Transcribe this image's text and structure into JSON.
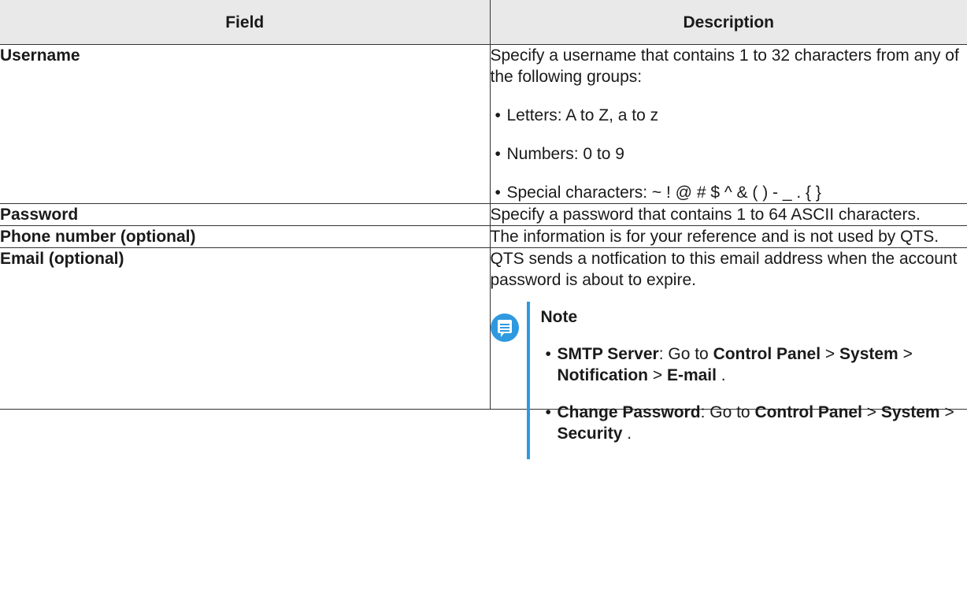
{
  "table": {
    "headers": [
      "Field",
      "Description"
    ],
    "username": {
      "field": "Username",
      "description": "Specify a username that contains 1 to 32 characters from any of the following groups:",
      "bullets": [
        "Letters: A to Z, a to z",
        "Numbers: 0 to 9",
        "Special characters: ~ ! @ # $ ^ & ( ) - _ . { }"
      ]
    },
    "password": {
      "field": "Password",
      "description": "Specify a password that contains 1 to 64 ASCII characters."
    },
    "phone": {
      "field": "Phone number (optional)",
      "description": "The information is for your reference and is not used by QTS."
    },
    "email": {
      "field": "Email (optional)",
      "description": "QTS sends a notfication to this email address when the account password is about to expire.",
      "note": {
        "title": "Note",
        "items": [
          {
            "label": "SMTP Server",
            "text": ": Go to ",
            "path": [
              "Control Panel",
              "System",
              "Notification",
              "E-mail"
            ],
            "end": " ."
          },
          {
            "label": "Change Password",
            "text": ": Go to ",
            "path": [
              "Control Panel",
              "System",
              "Security"
            ],
            "end": " ."
          }
        ]
      }
    }
  },
  "bullet_glyph": "•",
  "path_separator": " > ",
  "icon": "note-message-icon",
  "colors": {
    "header_bg": "#e9e9e9",
    "border": "#333333",
    "note_accent": "#2f99e0"
  }
}
